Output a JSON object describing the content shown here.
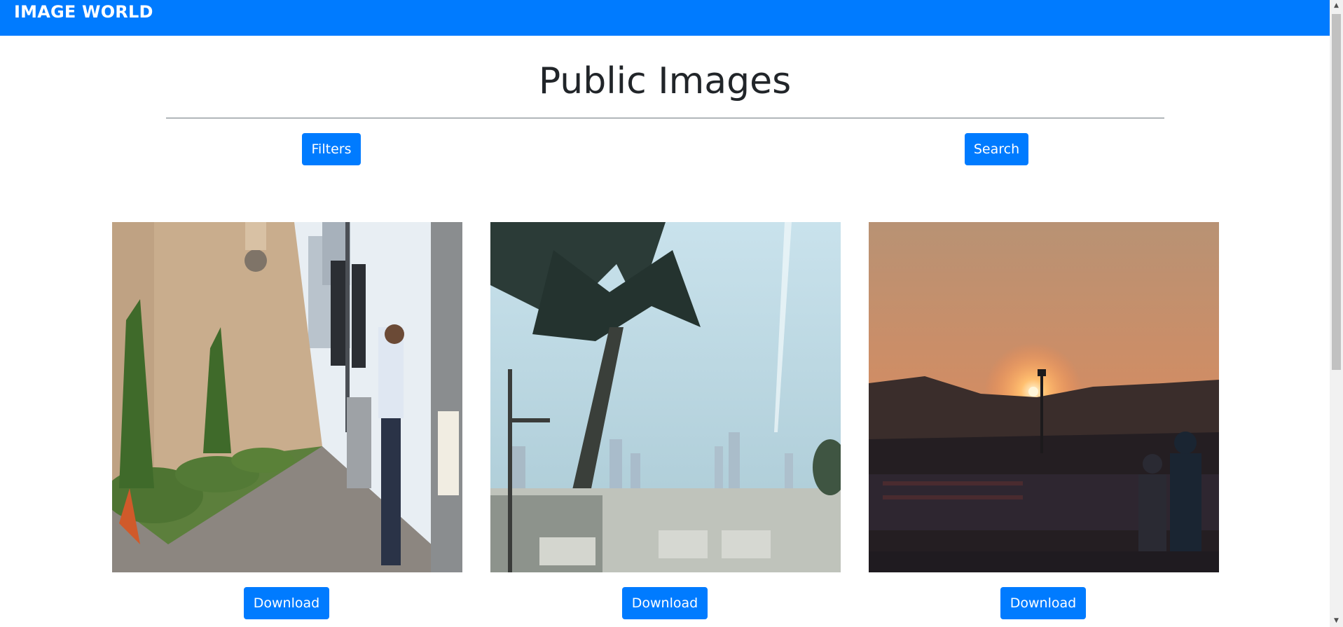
{
  "navbar": {
    "brand": "IMAGE WORLD",
    "color": "#007bff"
  },
  "page": {
    "title": "Public Images"
  },
  "controls": {
    "filters_label": "Filters",
    "search_label": "Search"
  },
  "gallery": {
    "images": [
      {
        "scene": "mall-sidewalk-man-at-parking-meter",
        "download_label": "Download"
      },
      {
        "scene": "palm-tree-city-skyline-haze",
        "download_label": "Download"
      },
      {
        "scene": "desert-sunset-over-stands",
        "download_label": "Download"
      }
    ]
  },
  "scrollbar": {
    "up_icon": "▲",
    "down_icon": "▼"
  }
}
